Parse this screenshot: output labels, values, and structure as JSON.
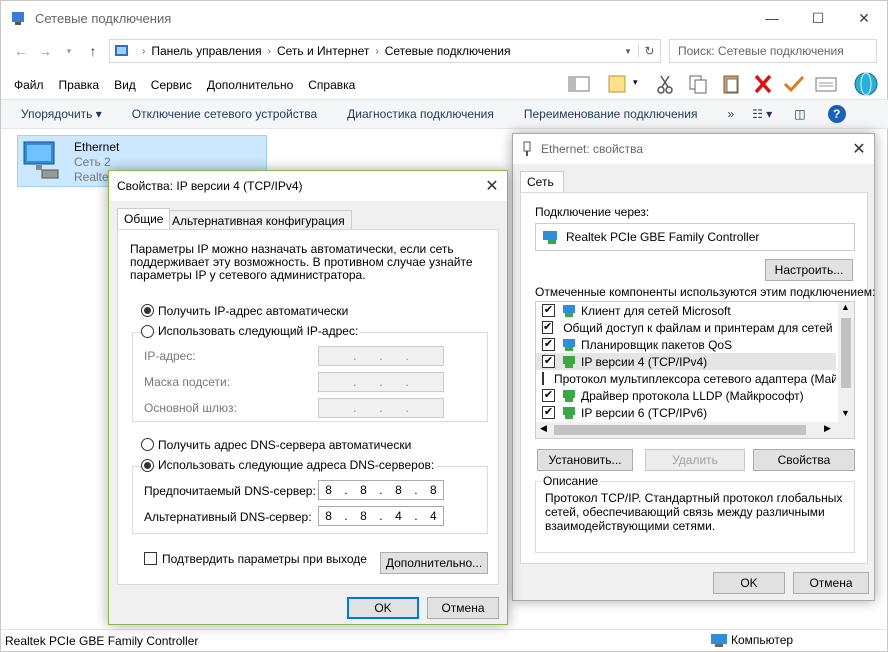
{
  "explorer": {
    "title": "Сетевые подключения",
    "controls": {
      "minimize": "—",
      "maximize": "☐",
      "close": "✕"
    },
    "breadcrumbs": [
      "Панель управления",
      "Сеть и Интернет",
      "Сетевые подключения"
    ],
    "search_placeholder": "Поиск: Сетевые подключения",
    "menu": [
      "Файл",
      "Правка",
      "Вид",
      "Сервис",
      "Дополнительно",
      "Справка"
    ],
    "commands": {
      "organize": "Упорядочить ▾",
      "disable": "Отключение сетевого устройства",
      "diagnose": "Диагностика подключения",
      "rename": "Переименование подключения",
      "more": "»"
    },
    "item": {
      "name": "Ethernet",
      "network": "Сеть  2",
      "adapter": "Realtek"
    },
    "status_left": "Realtek PCIe GBE Family Controller",
    "status_right": "Компьютер"
  },
  "ipv4": {
    "title": "Свойства: IP версии 4 (TCP/IPv4)",
    "tabs": [
      "Общие",
      "Альтернативная конфигурация"
    ],
    "description": [
      "Параметры IP можно назначать автоматически, если сеть",
      "поддерживает эту возможность. В противном случае узнайте",
      "параметры IP у сетевого администратора."
    ],
    "auto_ip": "Получить IP-адрес автоматически",
    "manual_ip": "Использовать следующий IP-адрес:",
    "ip_label": "IP-адрес:",
    "mask_label": "Маска подсети:",
    "gateway_label": "Основной шлюз:",
    "empty_ip": [
      ".",
      ".",
      "."
    ],
    "auto_dns": "Получить адрес DNS-сервера автоматически",
    "manual_dns": "Использовать следующие адреса DNS-серверов:",
    "preferred_label": "Предпочитаемый DNS-сервер:",
    "preferred_value": [
      "8",
      ".",
      "8",
      ".",
      "8",
      ".",
      "8"
    ],
    "alternate_label": "Альтернативный DNS-сервер:",
    "alternate_value": [
      "8",
      ".",
      "8",
      ".",
      "4",
      ".",
      "4"
    ],
    "validate": "Подтвердить параметры при выходе",
    "advanced": "Дополнительно...",
    "ok": "OK",
    "cancel": "Отмена"
  },
  "ethprops": {
    "title": "Ethernet: свойства",
    "tab": "Сеть",
    "connect_via": "Подключение через:",
    "adapter": "Realtek PCIe GBE Family Controller",
    "configure": "Настроить...",
    "components_label": "Отмеченные компоненты используются этим подключением:",
    "components": [
      {
        "label": "Клиент для сетей Microsoft",
        "checked": "✔"
      },
      {
        "label": "Общий доступ к файлам и принтерам для сетей Mi",
        "checked": "✔"
      },
      {
        "label": "Планировщик пакетов QoS",
        "checked": "✔"
      },
      {
        "label": "IP версии 4 (TCP/IPv4)",
        "checked": "✔"
      },
      {
        "label": "Протокол мультиплексора сетевого адаптера (Май",
        "checked": ""
      },
      {
        "label": "Драйвер протокола LLDP (Майкрософт)",
        "checked": "✔"
      },
      {
        "label": "IP версии 6 (TCP/IPv6)",
        "checked": "✔"
      }
    ],
    "install": "Установить...",
    "remove": "Удалить",
    "properties": "Свойства",
    "desc_title": "Описание",
    "desc": [
      "Протокол TCP/IP. Стандартный протокол глобальных",
      "сетей, обеспечивающий связь между различными",
      "взаимодействующими сетями."
    ],
    "ok": "OK",
    "cancel": "Отмена"
  }
}
